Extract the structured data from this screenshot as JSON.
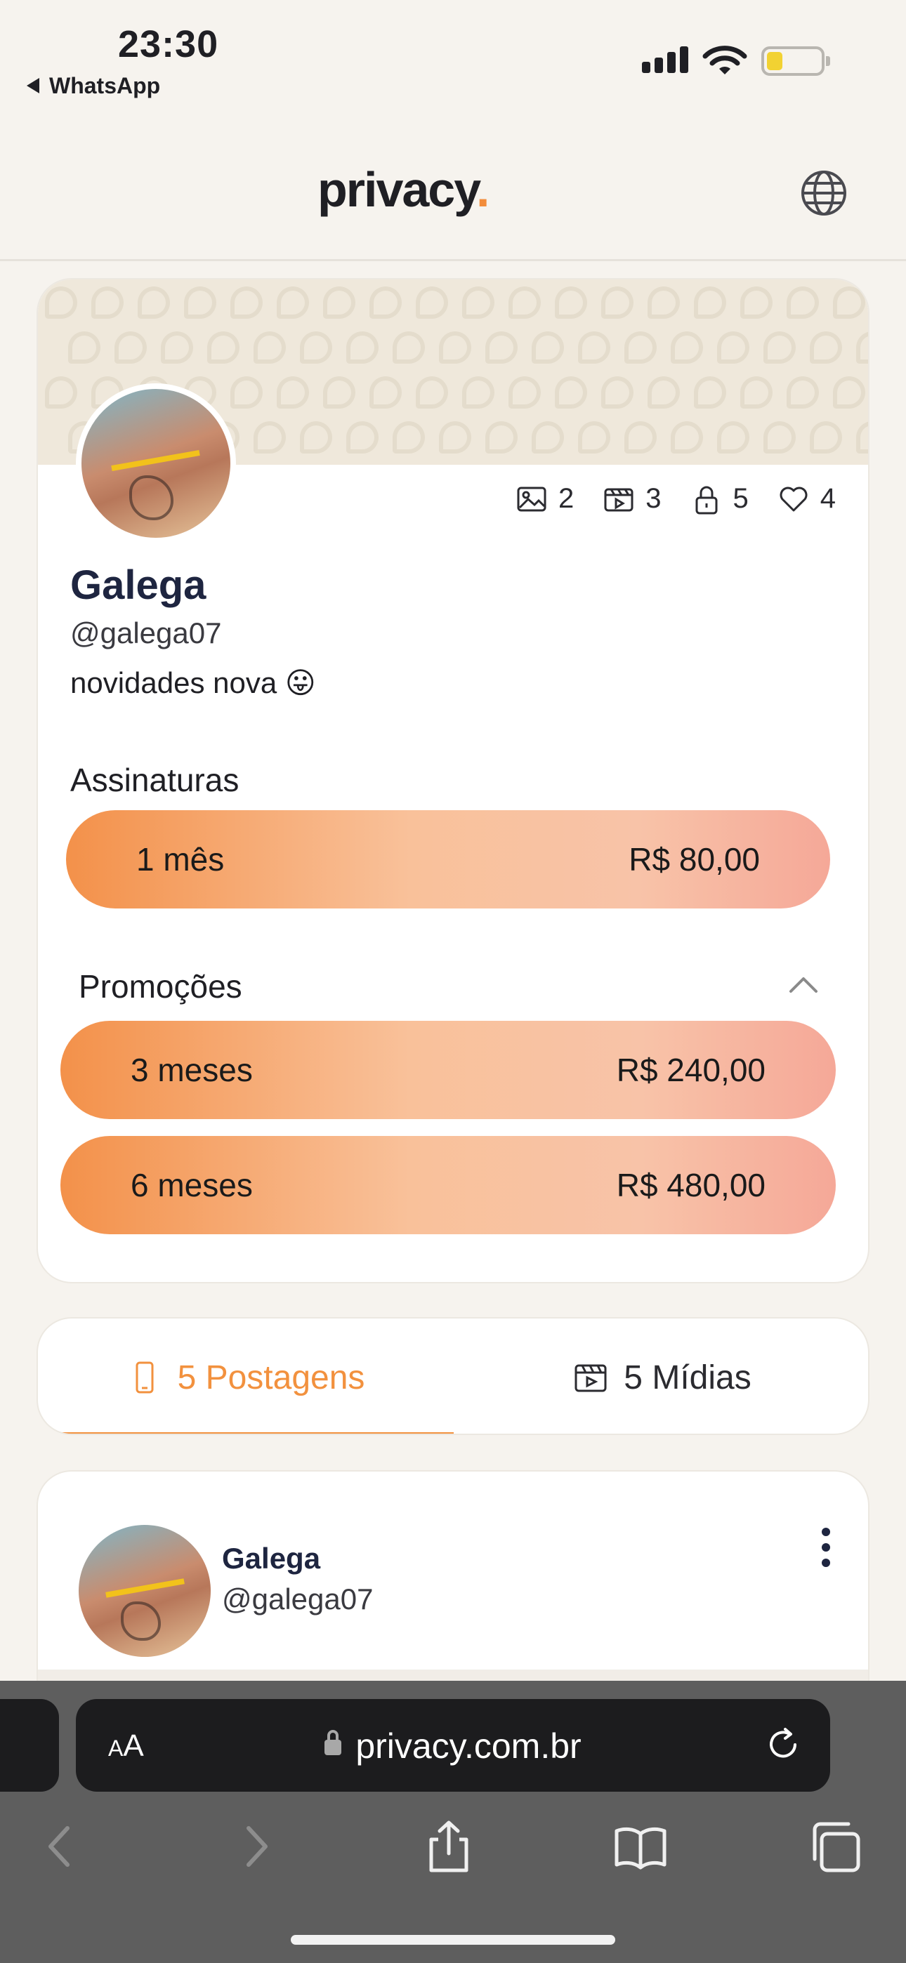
{
  "status_bar": {
    "time": "23:30",
    "back_app": "WhatsApp"
  },
  "header": {
    "logo_text": "privacy",
    "logo_dot": ".",
    "accent_color": "#f28c3a"
  },
  "profile": {
    "stats": [
      {
        "icon": "image-icon",
        "count": "2"
      },
      {
        "icon": "video-icon",
        "count": "3"
      },
      {
        "icon": "lock-icon",
        "count": "5"
      },
      {
        "icon": "heart-icon",
        "count": "4"
      }
    ],
    "name": "Galega",
    "handle": "@galega07",
    "bio": "novidades nova 😛",
    "subscriptions_title": "Assinaturas",
    "subscriptions": [
      {
        "label": "1 mês",
        "price": "R$ 80,00"
      }
    ],
    "promotions_title": "Promoções",
    "promotions": [
      {
        "label": "3 meses",
        "price": "R$ 240,00"
      },
      {
        "label": "6 meses",
        "price": "R$ 480,00"
      }
    ]
  },
  "tabs": [
    {
      "label": "5 Postagens",
      "active": true
    },
    {
      "label": "5 Mídias",
      "active": false
    }
  ],
  "post": {
    "name": "Galega",
    "handle": "@galega07"
  },
  "safari": {
    "aa_label": "AA",
    "url": "privacy.com.br"
  }
}
